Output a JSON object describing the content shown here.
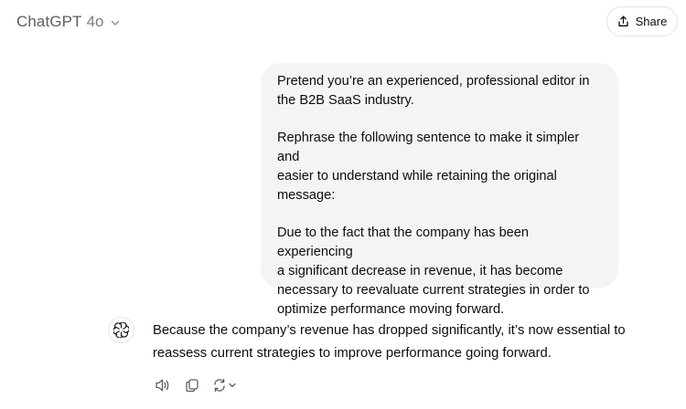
{
  "header": {
    "model_name": "ChatGPT",
    "model_version": "4o",
    "share_label": "Share"
  },
  "conversation": {
    "user_message": {
      "paragraphs": [
        "Pretend you’re an experienced, professional editor in\nthe B2B SaaS industry.",
        "Rephrase the following sentence to make it simpler and\neasier to understand while retaining the original\nmessage:",
        "Due to the fact that the company has been experiencing\na significant decrease in revenue, it has become\nnecessary to reevaluate current strategies in order to\noptimize performance moving forward."
      ]
    },
    "assistant_message": {
      "text": "Because the company’s revenue has dropped significantly, it’s now essential to reassess current strategies to improve performance going forward."
    }
  },
  "icons": {
    "model_dropdown": "chevron-down-icon",
    "share": "share-icon",
    "assistant_avatar": "openai-logo-icon",
    "read_aloud": "speaker-icon",
    "copy": "copy-icon",
    "regenerate": "regenerate-icon"
  },
  "colors": {
    "user_bubble_bg": "#f4f4f4",
    "model_name_text": "#5d5d5d"
  }
}
